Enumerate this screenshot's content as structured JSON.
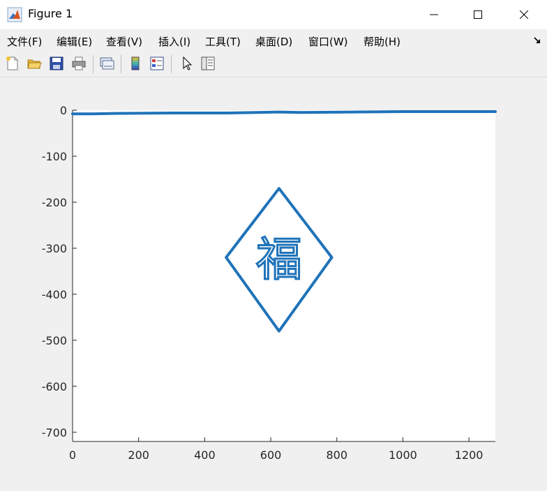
{
  "window": {
    "title": "Figure 1",
    "app_icon": "matlab-icon",
    "controls": [
      "minimize-icon",
      "maximize-icon",
      "close-icon"
    ]
  },
  "menu": {
    "items": [
      {
        "label": "文件(F)"
      },
      {
        "label": "编辑(E)"
      },
      {
        "label": "查看(V)"
      },
      {
        "label": "插入(I)"
      },
      {
        "label": "工具(T)"
      },
      {
        "label": "桌面(D)"
      },
      {
        "label": "窗口(W)"
      },
      {
        "label": "帮助(H)"
      }
    ],
    "dock_icon": "dock-arrow-icon"
  },
  "toolbar": {
    "buttons": [
      "new-figure-icon",
      "open-file-icon",
      "save-icon",
      "print-icon",
      "link-plot-icon",
      "insert-colorbar-icon",
      "insert-legend-icon",
      "edit-plot-icon",
      "property-inspector-icon"
    ]
  },
  "colors": {
    "line": "#1f73b9",
    "axes_bg": "#ffffff",
    "figure_bg": "#f0f0f0",
    "tick_text": "#262626"
  },
  "chart_data": {
    "type": "line",
    "title": "",
    "xlabel": "",
    "ylabel": "",
    "xlim": [
      0,
      1280
    ],
    "ylim": [
      -720,
      0
    ],
    "xticks": [
      0,
      200,
      400,
      600,
      800,
      1000,
      1200
    ],
    "yticks": [
      0,
      -100,
      -200,
      -300,
      -400,
      -500,
      -600,
      -700
    ],
    "grid": false,
    "series": [
      {
        "label": "top-border-line",
        "x": [
          0,
          60,
          130,
          300,
          470,
          625,
          690,
          1000,
          1280
        ],
        "y": [
          -8,
          -8,
          -7,
          -6,
          -6,
          -4,
          -5,
          -3,
          -3
        ]
      },
      {
        "label": "diamond-outline",
        "x": [
          625,
          785,
          625,
          465,
          625
        ],
        "y": [
          -170,
          -320,
          -480,
          -320,
          -170
        ]
      }
    ],
    "annotation": {
      "text": "福",
      "x": 625,
      "y": -325
    }
  }
}
